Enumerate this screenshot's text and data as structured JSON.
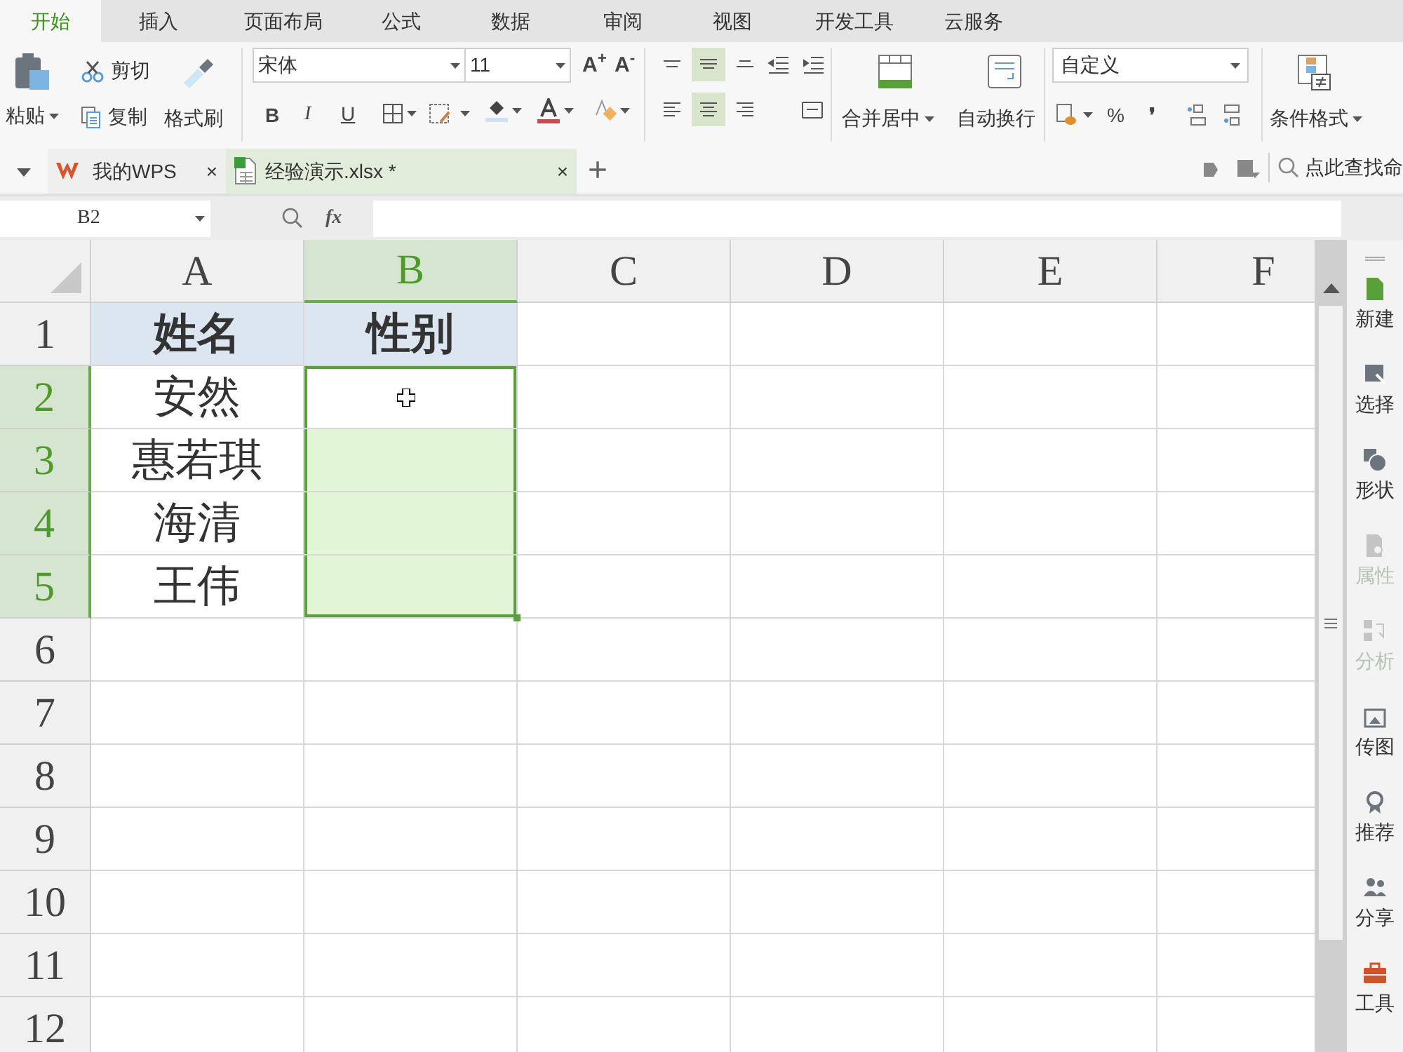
{
  "menu_tabs": [
    {
      "label": "开始",
      "selected": true
    },
    {
      "label": "插入",
      "selected": false
    },
    {
      "label": "页面布局",
      "selected": false
    },
    {
      "label": "公式",
      "selected": false
    },
    {
      "label": "数据",
      "selected": false
    },
    {
      "label": "审阅",
      "selected": false
    },
    {
      "label": "视图",
      "selected": false
    },
    {
      "label": "开发工具",
      "selected": false
    },
    {
      "label": "云服务",
      "selected": false
    }
  ],
  "ribbon": {
    "paste": "粘贴",
    "cut": "剪切",
    "copy": "复制",
    "format_painter": "格式刷",
    "font_name": "宋体",
    "font_size": "11",
    "grow_font": "A$^{+}$",
    "shrink_font": "A$^{-}$",
    "bold": "B",
    "italic": "I",
    "underline": "U",
    "align_buttons": [
      {
        "kind": "top",
        "selected": false
      },
      {
        "kind": "middle",
        "selected": true
      },
      {
        "kind": "bottom",
        "selected": false
      },
      {
        "kind": "left",
        "selected": false
      },
      {
        "kind": "center",
        "selected": true
      },
      {
        "kind": "right",
        "selected": false
      }
    ],
    "merge": "合并居中",
    "wrap": "自动换行",
    "number_format": "自定义",
    "percent": "%",
    "comma": "❜",
    "conditional_format": "条件格式"
  },
  "doc_tabs": [
    {
      "label": "我的WPS",
      "close": "×",
      "selected": false
    },
    {
      "label": "经验演示.xlsx *",
      "close": "×",
      "selected": true
    }
  ],
  "new_tab": "+",
  "command_search": "点此查找命",
  "formula_bar": {
    "name_box": "B2",
    "fx": "fx"
  },
  "columns": [
    {
      "label": "A",
      "selected": false
    },
    {
      "label": "B",
      "selected": true
    },
    {
      "label": "C",
      "selected": false
    },
    {
      "label": "D",
      "selected": false
    },
    {
      "label": "E",
      "selected": false
    },
    {
      "label": "F",
      "selected": false
    }
  ],
  "rows": [
    {
      "label": "1",
      "selected": false,
      "cells": [
        {
          "text": "姓名",
          "shaded": true,
          "selected": false
        },
        {
          "text": "性别",
          "shaded": true,
          "selected": false
        }
      ]
    },
    {
      "label": "2",
      "selected": true,
      "cells": [
        {
          "text": "安然",
          "shaded": false,
          "selected": false
        },
        {
          "shaded": false,
          "selected": true,
          "active": true
        }
      ]
    },
    {
      "label": "3",
      "selected": true,
      "cells": [
        {
          "text": "惠若琪",
          "shaded": false,
          "selected": false
        },
        {
          "shaded": false,
          "selected": true,
          "active": false
        }
      ]
    },
    {
      "label": "4",
      "selected": true,
      "cells": [
        {
          "text": "海清",
          "shaded": false,
          "selected": false
        },
        {
          "shaded": false,
          "selected": true,
          "active": false
        }
      ]
    },
    {
      "label": "5",
      "selected": true,
      "cells": [
        {
          "text": "王伟",
          "shaded": false,
          "selected": false
        },
        {
          "shaded": false,
          "selected": true,
          "active": false
        }
      ]
    },
    {
      "label": "6",
      "selected": false
    },
    {
      "label": "7",
      "selected": false
    },
    {
      "label": "8",
      "selected": false
    },
    {
      "label": "9",
      "selected": false
    },
    {
      "label": "10",
      "selected": false
    },
    {
      "label": "11",
      "selected": false
    },
    {
      "label": "12",
      "selected": false
    }
  ],
  "sidebar": [
    {
      "kind": "new",
      "label": "新建",
      "disabled": false
    },
    {
      "kind": "select",
      "label": "选择",
      "disabled": false
    },
    {
      "kind": "shape",
      "label": "形状",
      "disabled": false
    },
    {
      "kind": "property",
      "label": "属性",
      "disabled": true
    },
    {
      "kind": "analyze",
      "label": "分析",
      "disabled": true
    },
    {
      "kind": "image",
      "label": "传图",
      "disabled": false
    },
    {
      "kind": "recommend",
      "label": "推荐",
      "disabled": false
    },
    {
      "kind": "share",
      "label": "分享",
      "disabled": false
    },
    {
      "kind": "tools",
      "label": "工具",
      "disabled": false
    }
  ]
}
